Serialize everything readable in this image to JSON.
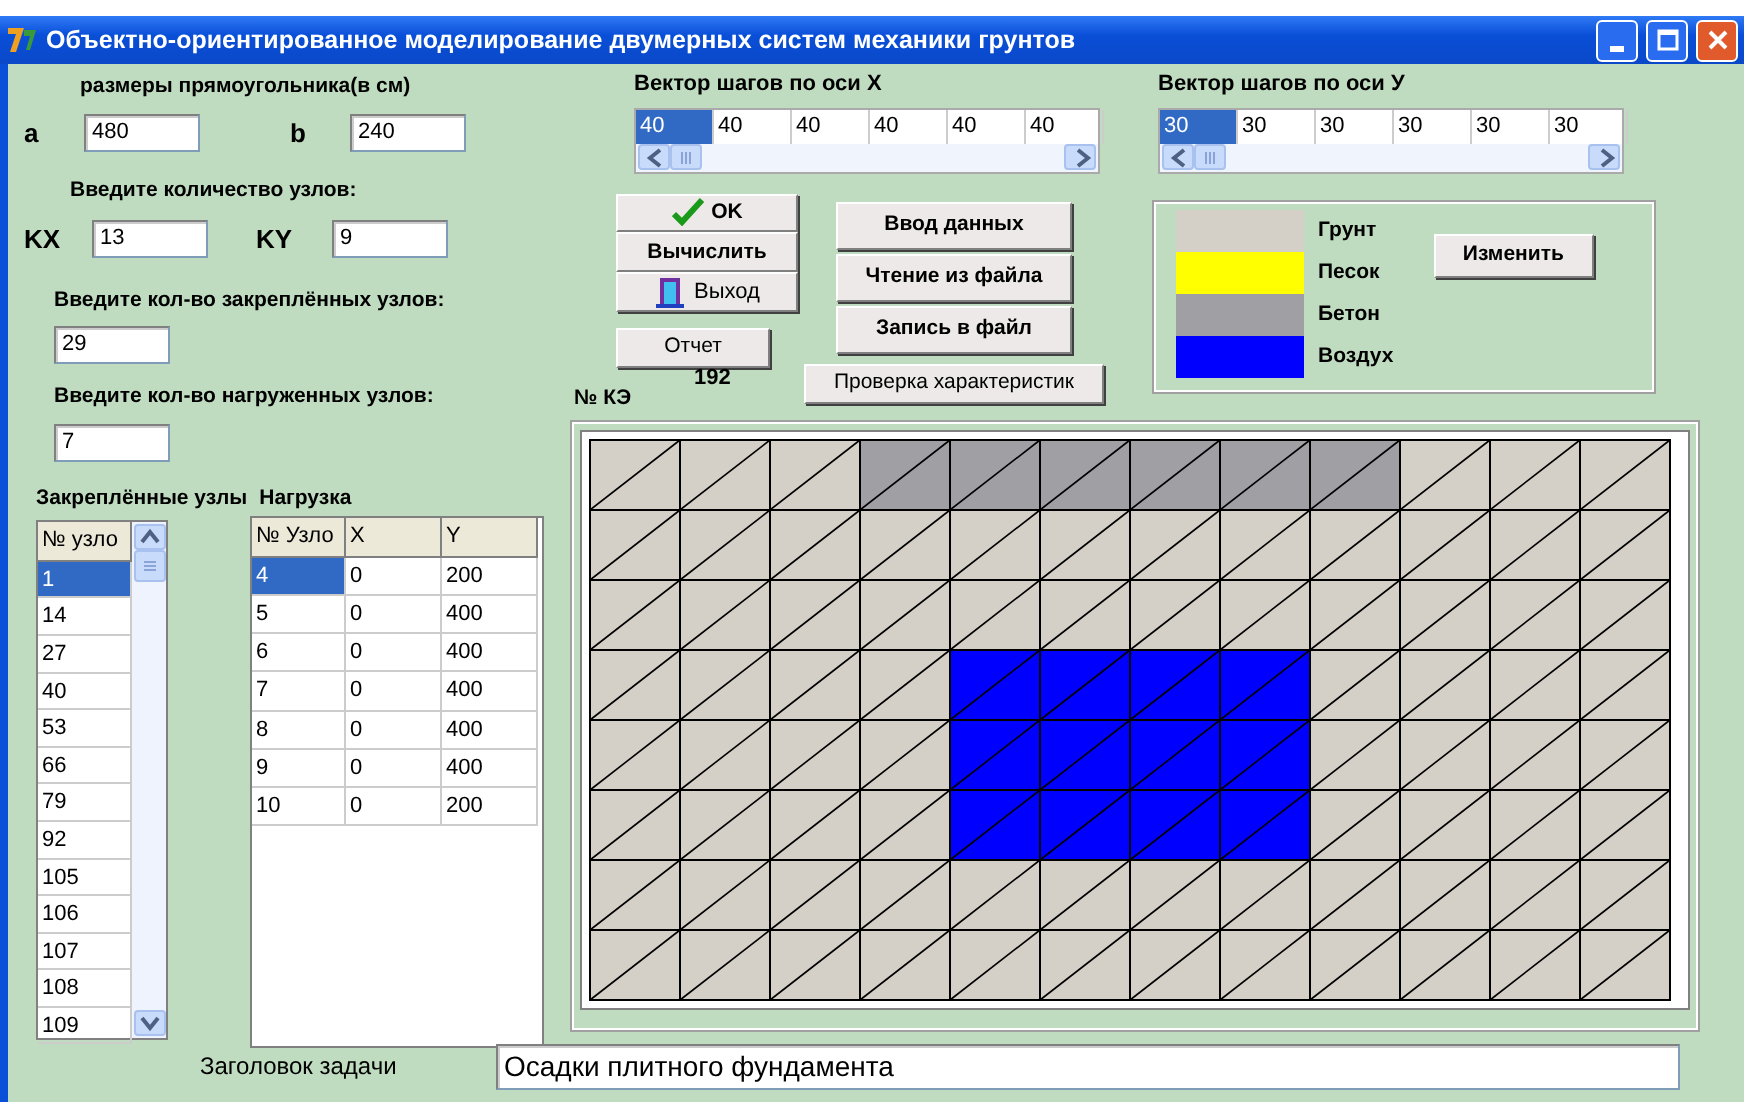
{
  "window": {
    "title": "Объектно-ориентированное моделирование двумерных систем механики грунтов"
  },
  "dimensions": {
    "heading": "размеры прямоугольника(в см)",
    "fields": [
      {
        "label": "a",
        "value": "480"
      },
      {
        "label": "b",
        "value": "240"
      }
    ]
  },
  "nodes": {
    "heading": "Введите количество узлов:",
    "fields": [
      {
        "label": "KX",
        "value": "13"
      },
      {
        "label": "KY",
        "value": "9"
      }
    ]
  },
  "fixed_count": {
    "label": "Введите кол-во закреплённых узлов:",
    "value": "29"
  },
  "loaded_count": {
    "label": "Введите кол-во нагруженных узлов:",
    "value": "7"
  },
  "lists_heading": [
    "Закреплённые узлы",
    "Нагрузка"
  ],
  "fixed_nodes": {
    "column": "№ узло",
    "rows": [
      {
        "value": "1",
        "selected": true
      },
      {
        "value": "14",
        "selected": false
      },
      {
        "value": "27",
        "selected": false
      },
      {
        "value": "40",
        "selected": false
      },
      {
        "value": "53",
        "selected": false
      },
      {
        "value": "66",
        "selected": false
      },
      {
        "value": "79",
        "selected": false
      },
      {
        "value": "92",
        "selected": false
      },
      {
        "value": "105",
        "selected": false
      },
      {
        "value": "106",
        "selected": false
      },
      {
        "value": "107",
        "selected": false
      },
      {
        "value": "108",
        "selected": false
      },
      {
        "value": "109",
        "selected": false
      }
    ]
  },
  "loads": {
    "columns": [
      "№ Узло",
      "X",
      "Y"
    ],
    "rows": [
      {
        "cells": [
          "4",
          "0",
          "200"
        ],
        "selected": true
      },
      {
        "cells": [
          "5",
          "0",
          "400"
        ],
        "selected": false
      },
      {
        "cells": [
          "6",
          "0",
          "400"
        ],
        "selected": false
      },
      {
        "cells": [
          "7",
          "0",
          "400"
        ],
        "selected": false
      },
      {
        "cells": [
          "8",
          "0",
          "400"
        ],
        "selected": false
      },
      {
        "cells": [
          "9",
          "0",
          "400"
        ],
        "selected": false
      },
      {
        "cells": [
          "10",
          "0",
          "200"
        ],
        "selected": false
      }
    ]
  },
  "vectors": [
    {
      "label": "Вектор шагов по оси X",
      "cells": [
        {
          "value": "40",
          "selected": true
        },
        {
          "value": "40",
          "selected": false
        },
        {
          "value": "40",
          "selected": false
        },
        {
          "value": "40",
          "selected": false
        },
        {
          "value": "40",
          "selected": false
        },
        {
          "value": "40",
          "selected": false
        }
      ]
    },
    {
      "label": "Вектор шагов по оси У",
      "cells": [
        {
          "value": "30",
          "selected": true
        },
        {
          "value": "30",
          "selected": false
        },
        {
          "value": "30",
          "selected": false
        },
        {
          "value": "30",
          "selected": false
        },
        {
          "value": "30",
          "selected": false
        },
        {
          "value": "30",
          "selected": false
        }
      ]
    }
  ],
  "action_buttons": [
    {
      "label": "OK",
      "kind": "check"
    },
    {
      "label": "Вычислить",
      "kind": "plain"
    },
    {
      "label": "Выход",
      "kind": "exit"
    }
  ],
  "report_button": "Отчет",
  "element_count": {
    "label": "№ КЭ",
    "value": "192"
  },
  "data_buttons": [
    "Ввод данных",
    "Чтение из файла",
    "Запись в файл"
  ],
  "check_button": "Проверка характеристик",
  "legend": {
    "materials": [
      {
        "name": "Грунт",
        "color": "#d4d0c8"
      },
      {
        "name": "Песок",
        "color": "#ffff00"
      },
      {
        "name": "Бетон",
        "color": "#a0a0a4"
      },
      {
        "name": "Воздух",
        "color": "#0000ff"
      }
    ],
    "button": "Изменить"
  },
  "mesh": {
    "rows": [
      {
        "cells": [
          {
            "color": "#d4d0c8"
          },
          {
            "color": "#d4d0c8"
          },
          {
            "color": "#d4d0c8"
          },
          {
            "color": "#a0a0a4"
          },
          {
            "color": "#a0a0a4"
          },
          {
            "color": "#a0a0a4"
          },
          {
            "color": "#a0a0a4"
          },
          {
            "color": "#a0a0a4"
          },
          {
            "color": "#a0a0a4"
          },
          {
            "color": "#d4d0c8"
          },
          {
            "color": "#d4d0c8"
          },
          {
            "color": "#d4d0c8"
          }
        ]
      },
      {
        "cells": [
          {
            "color": "#d4d0c8"
          },
          {
            "color": "#d4d0c8"
          },
          {
            "color": "#d4d0c8"
          },
          {
            "color": "#d4d0c8"
          },
          {
            "color": "#d4d0c8"
          },
          {
            "color": "#d4d0c8"
          },
          {
            "color": "#d4d0c8"
          },
          {
            "color": "#d4d0c8"
          },
          {
            "color": "#d4d0c8"
          },
          {
            "color": "#d4d0c8"
          },
          {
            "color": "#d4d0c8"
          },
          {
            "color": "#d4d0c8"
          }
        ]
      },
      {
        "cells": [
          {
            "color": "#d4d0c8"
          },
          {
            "color": "#d4d0c8"
          },
          {
            "color": "#d4d0c8"
          },
          {
            "color": "#d4d0c8"
          },
          {
            "color": "#d4d0c8"
          },
          {
            "color": "#d4d0c8"
          },
          {
            "color": "#d4d0c8"
          },
          {
            "color": "#d4d0c8"
          },
          {
            "color": "#d4d0c8"
          },
          {
            "color": "#d4d0c8"
          },
          {
            "color": "#d4d0c8"
          },
          {
            "color": "#d4d0c8"
          }
        ]
      },
      {
        "cells": [
          {
            "color": "#d4d0c8"
          },
          {
            "color": "#d4d0c8"
          },
          {
            "color": "#d4d0c8"
          },
          {
            "color": "#d4d0c8"
          },
          {
            "color": "#0000ff"
          },
          {
            "color": "#0000ff"
          },
          {
            "color": "#0000ff"
          },
          {
            "color": "#0000ff"
          },
          {
            "color": "#d4d0c8"
          },
          {
            "color": "#d4d0c8"
          },
          {
            "color": "#d4d0c8"
          },
          {
            "color": "#d4d0c8"
          }
        ]
      },
      {
        "cells": [
          {
            "color": "#d4d0c8"
          },
          {
            "color": "#d4d0c8"
          },
          {
            "color": "#d4d0c8"
          },
          {
            "color": "#d4d0c8"
          },
          {
            "color": "#0000ff"
          },
          {
            "color": "#0000ff"
          },
          {
            "color": "#0000ff"
          },
          {
            "color": "#0000ff"
          },
          {
            "color": "#d4d0c8"
          },
          {
            "color": "#d4d0c8"
          },
          {
            "color": "#d4d0c8"
          },
          {
            "color": "#d4d0c8"
          }
        ]
      },
      {
        "cells": [
          {
            "color": "#d4d0c8"
          },
          {
            "color": "#d4d0c8"
          },
          {
            "color": "#d4d0c8"
          },
          {
            "color": "#d4d0c8"
          },
          {
            "color": "#0000ff"
          },
          {
            "color": "#0000ff"
          },
          {
            "color": "#0000ff"
          },
          {
            "color": "#0000ff"
          },
          {
            "color": "#d4d0c8"
          },
          {
            "color": "#d4d0c8"
          },
          {
            "color": "#d4d0c8"
          },
          {
            "color": "#d4d0c8"
          }
        ]
      },
      {
        "cells": [
          {
            "color": "#d4d0c8"
          },
          {
            "color": "#d4d0c8"
          },
          {
            "color": "#d4d0c8"
          },
          {
            "color": "#d4d0c8"
          },
          {
            "color": "#d4d0c8"
          },
          {
            "color": "#d4d0c8"
          },
          {
            "color": "#d4d0c8"
          },
          {
            "color": "#d4d0c8"
          },
          {
            "color": "#d4d0c8"
          },
          {
            "color": "#d4d0c8"
          },
          {
            "color": "#d4d0c8"
          },
          {
            "color": "#d4d0c8"
          }
        ]
      },
      {
        "cells": [
          {
            "color": "#d4d0c8"
          },
          {
            "color": "#d4d0c8"
          },
          {
            "color": "#d4d0c8"
          },
          {
            "color": "#d4d0c8"
          },
          {
            "color": "#d4d0c8"
          },
          {
            "color": "#d4d0c8"
          },
          {
            "color": "#d4d0c8"
          },
          {
            "color": "#d4d0c8"
          },
          {
            "color": "#d4d0c8"
          },
          {
            "color": "#d4d0c8"
          },
          {
            "color": "#d4d0c8"
          },
          {
            "color": "#d4d0c8"
          }
        ]
      }
    ]
  },
  "task_title": {
    "label": "Заголовок задачи",
    "value": "Осадки плитного фундамента"
  }
}
